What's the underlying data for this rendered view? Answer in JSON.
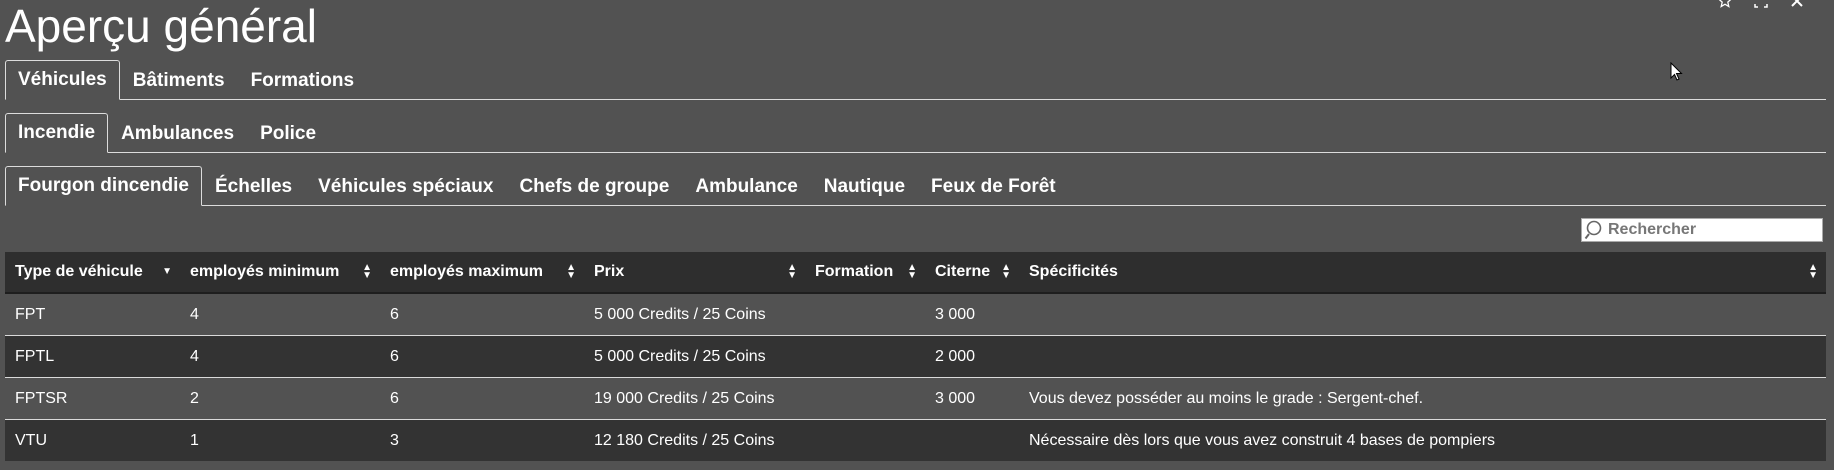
{
  "title": "Aperçu général",
  "window_controls": [
    "star-icon",
    "maximize-icon",
    "close-icon"
  ],
  "main_tabs": [
    {
      "label": "Véhicules",
      "active": true
    },
    {
      "label": "Bâtiments",
      "active": false
    },
    {
      "label": "Formations",
      "active": false
    }
  ],
  "category_tabs": [
    {
      "label": "Incendie",
      "active": true
    },
    {
      "label": "Ambulances",
      "active": false
    },
    {
      "label": "Police",
      "active": false
    }
  ],
  "sub_tabs": [
    {
      "label": "Fourgon dincendie",
      "active": true
    },
    {
      "label": "Échelles",
      "active": false
    },
    {
      "label": "Véhicules spéciaux",
      "active": false
    },
    {
      "label": "Chefs de groupe",
      "active": false
    },
    {
      "label": "Ambulance",
      "active": false
    },
    {
      "label": "Nautique",
      "active": false
    },
    {
      "label": "Feux de Forêt",
      "active": false
    }
  ],
  "search": {
    "placeholder": "Rechercher",
    "value": ""
  },
  "table": {
    "columns": [
      {
        "label": "Type de véhicule",
        "sort": "desc"
      },
      {
        "label": "employés minimum",
        "sort": "both"
      },
      {
        "label": "employés maximum",
        "sort": "both"
      },
      {
        "label": "Prix",
        "sort": "both"
      },
      {
        "label": "Formation",
        "sort": "both"
      },
      {
        "label": "Citerne",
        "sort": "both"
      },
      {
        "label": "Spécificités",
        "sort": "both"
      }
    ],
    "rows": [
      [
        "FPT",
        "4",
        "6",
        "5 000 Credits / 25 Coins",
        "",
        "3 000",
        ""
      ],
      [
        "FPTL",
        "4",
        "6",
        "5 000 Credits / 25 Coins",
        "",
        "2 000",
        ""
      ],
      [
        "FPTSR",
        "2",
        "6",
        "19 000 Credits / 25 Coins",
        "",
        "3 000",
        "Vous devez posséder au moins le grade : Sergent-chef."
      ],
      [
        "VTU",
        "1",
        "3",
        "12 180 Credits / 25 Coins",
        "",
        "",
        "Nécessaire dès lors que vous avez construit 4 bases de pompiers"
      ]
    ]
  }
}
